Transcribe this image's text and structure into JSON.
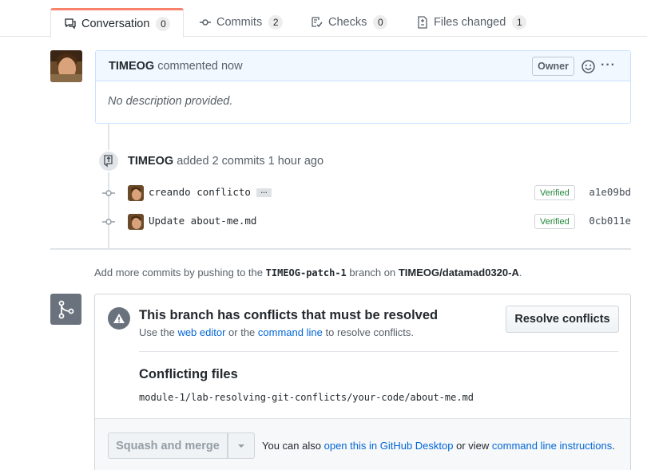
{
  "tabs": [
    {
      "label": "Conversation",
      "count": "0",
      "icon": "comment-discussion-icon"
    },
    {
      "label": "Commits",
      "count": "2",
      "icon": "git-commit-icon"
    },
    {
      "label": "Checks",
      "count": "0",
      "icon": "checklist-icon"
    },
    {
      "label": "Files changed",
      "count": "1",
      "icon": "file-diff-icon"
    }
  ],
  "comment": {
    "author": "TIMEOG",
    "action": "commented now",
    "badge": "Owner",
    "body": "No description provided."
  },
  "timeline": {
    "author": "TIMEOG",
    "action": "added 2 commits 1 hour ago"
  },
  "commits": [
    {
      "message": "creando conflicto",
      "verified": "Verified",
      "sha": "a1e09bd",
      "has_more": true,
      "more_label": "…"
    },
    {
      "message": "Update about-me.md",
      "verified": "Verified",
      "sha": "0cb011e",
      "has_more": false
    }
  ],
  "push_note": {
    "prefix": "Add more commits by pushing to the",
    "branch": "TIMEOG-patch-1",
    "middle": "branch on",
    "repo": "TIMEOG/datamad0320-A",
    "suffix": "."
  },
  "merge": {
    "title": "This branch has conflicts that must be resolved",
    "sub_prefix": "Use the",
    "sub_link1": "web editor",
    "sub_middle": "or the",
    "sub_link2": "command line",
    "sub_suffix": "to resolve conflicts.",
    "resolve_button": "Resolve conflicts",
    "files_title": "Conflicting files",
    "file_path": "module-1/lab-resolving-git-conflicts/your-code/about-me.md",
    "squash_button": "Squash and merge",
    "footer_prefix": "You can also",
    "footer_link1": "open this in GitHub Desktop",
    "footer_middle": "or view",
    "footer_link2": "command line instructions",
    "footer_suffix": "."
  },
  "colors": {
    "link": "#0366d6",
    "verified": "#22863a",
    "tab_accent": "#f9826c",
    "comment_header_bg": "#f1f8ff"
  }
}
